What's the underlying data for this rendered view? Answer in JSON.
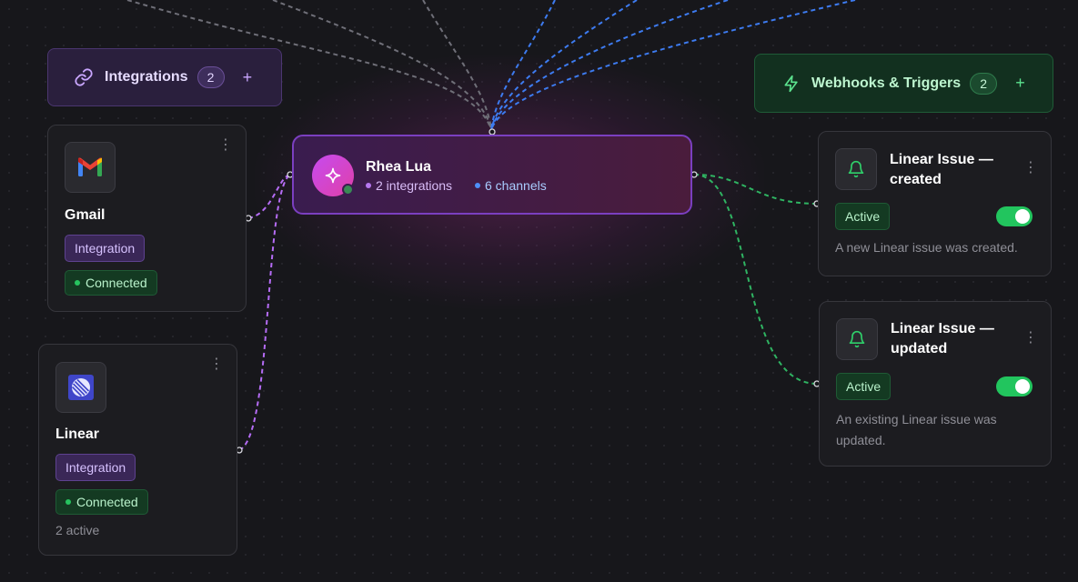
{
  "integrations_header": {
    "label": "Integrations",
    "count": "2",
    "add": "+"
  },
  "webhooks_header": {
    "label": "Webhooks & Triggers",
    "count": "2",
    "add": "+"
  },
  "integrations": [
    {
      "name": "Gmail",
      "icon": "gmail-logo-icon",
      "tag": "Integration",
      "status": "Connected"
    },
    {
      "name": "Linear",
      "icon": "linear-logo-icon",
      "tag": "Integration",
      "status": "Connected",
      "extra": "2 active"
    }
  ],
  "agent": {
    "name": "Rhea Lua",
    "integrations": "2 integrations",
    "channels": "6 channels",
    "icon": "sparkle-icon"
  },
  "triggers": [
    {
      "title": "Linear Issue — created",
      "status": "Active",
      "enabled": true,
      "description": "A new Linear issue was created.",
      "icon": "bell-icon"
    },
    {
      "title": "Linear Issue — updated",
      "status": "Active",
      "enabled": true,
      "description": "An existing Linear issue was updated.",
      "icon": "bell-icon"
    }
  ],
  "colors": {
    "integration_edge": "#b56cf5",
    "channel_edge": "#3d7bf0",
    "trigger_edge": "#2fb462",
    "gray_edge": "#6f6f78",
    "accent": "#7b3fc0"
  }
}
